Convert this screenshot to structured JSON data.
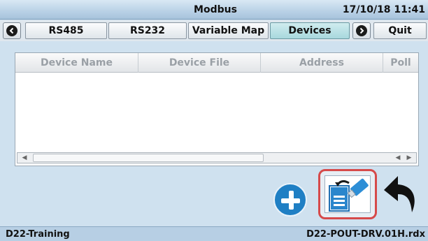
{
  "app": {
    "title": "Modbus",
    "datetime": "17/10/18 11:41"
  },
  "tabs": [
    {
      "label": "RS485",
      "active": false
    },
    {
      "label": "RS232",
      "active": false
    },
    {
      "label": "Variable Map",
      "active": false
    },
    {
      "label": "Devices",
      "active": true
    },
    {
      "label": "Quit",
      "active": false
    }
  ],
  "table": {
    "columns": [
      "Device Name",
      "Device File",
      "Address",
      "Poll"
    ],
    "rows": []
  },
  "icons": {
    "prev": "chevron-left-icon",
    "next": "chevron-right-icon",
    "add": "plus-icon",
    "import": "usb-import-icon",
    "back": "undo-arrow-icon"
  },
  "status": {
    "left": "D22-Training",
    "right": "D22-POUT-DRV.01H.rdx"
  },
  "colors": {
    "accent": "#1f7fc4",
    "active_tab": "#a8d8dd",
    "highlight": "#d64a4a"
  }
}
